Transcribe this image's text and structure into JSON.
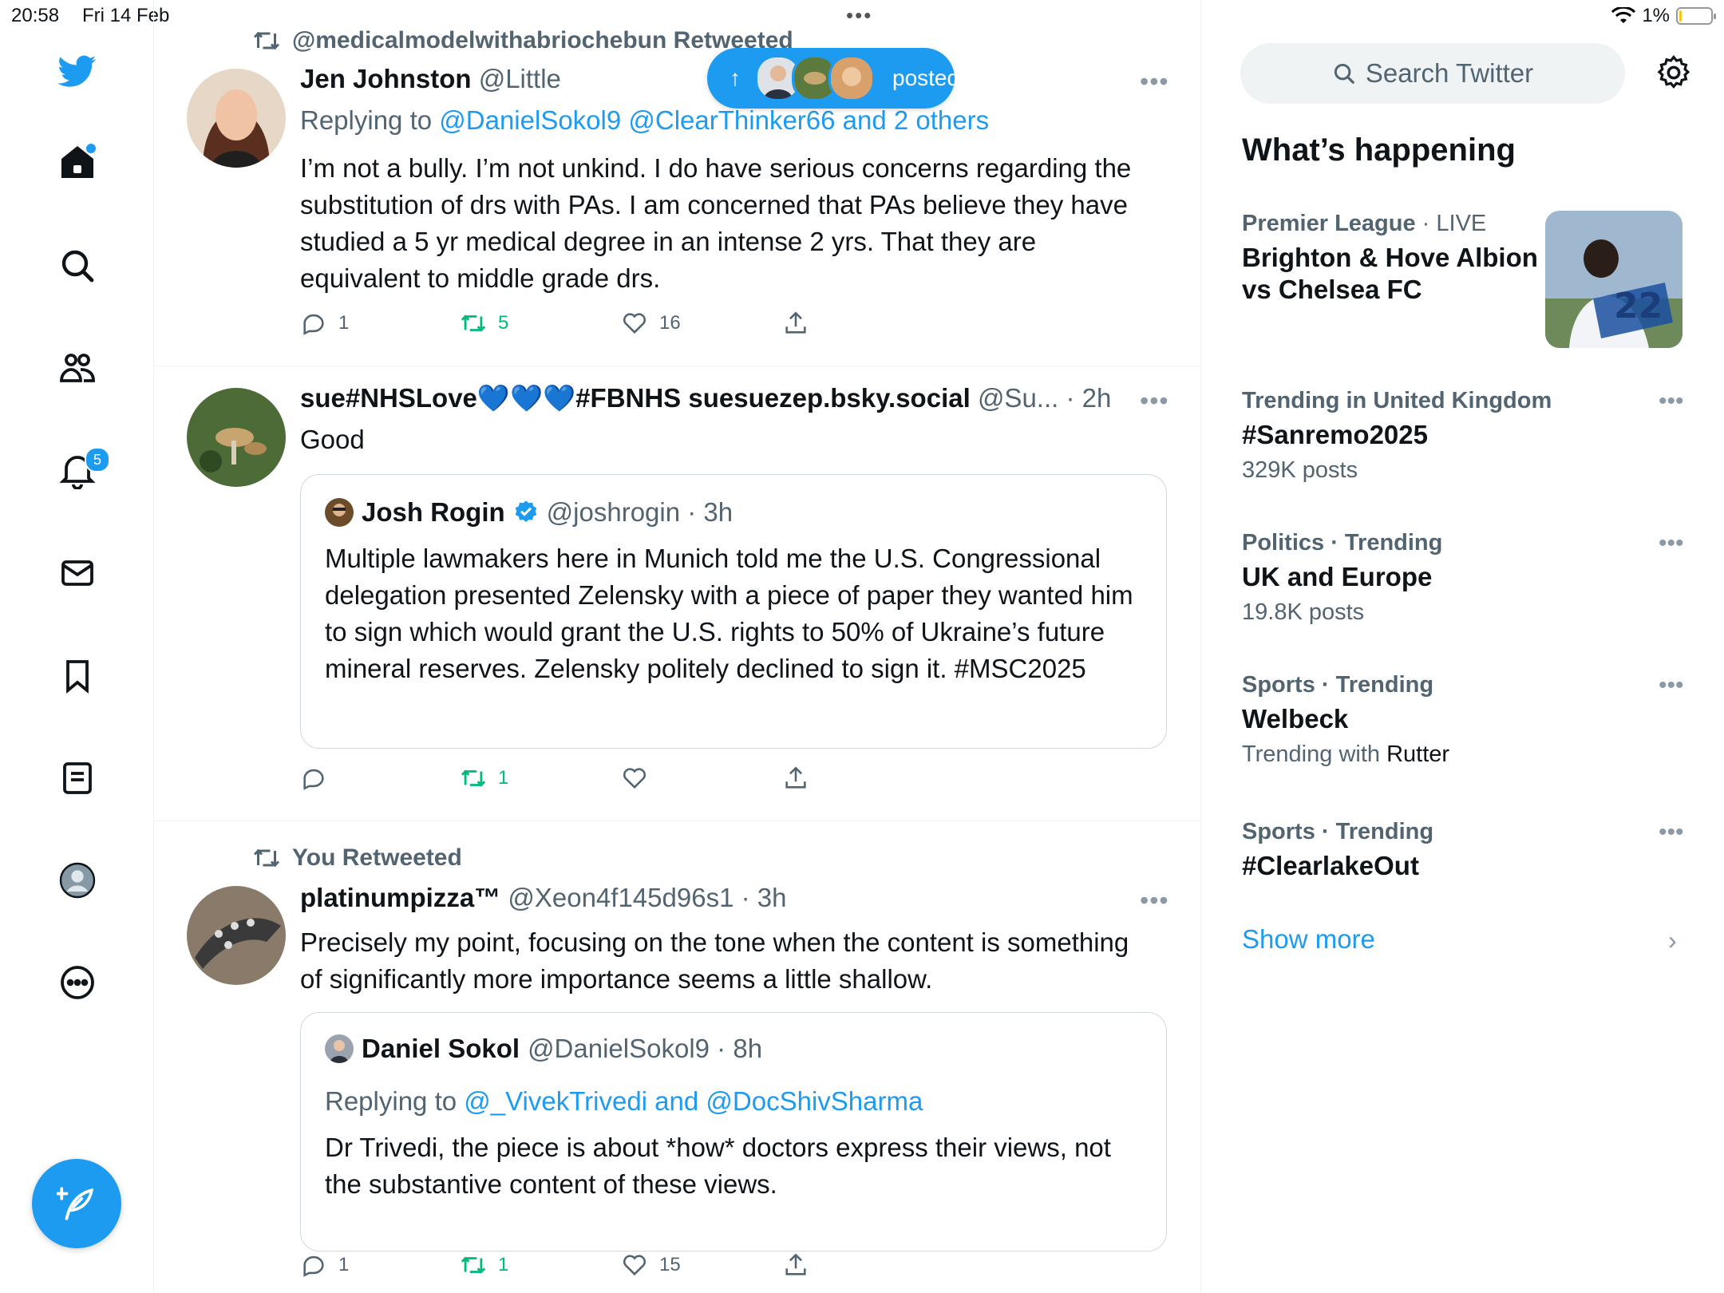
{
  "status": {
    "time": "20:58",
    "date": "Fri 14 Feb",
    "battery": "1%",
    "dots": "•••"
  },
  "nav": {
    "notifications_badge": "5"
  },
  "new_posts": {
    "label": "posted",
    "arrow": "↑"
  },
  "tweets": [
    {
      "context": "@medicalmodelwithabriochebun Retweeted",
      "name": "Jen Johnston",
      "handle": "@Little",
      "replying_prefix": "Replying to ",
      "replying_to": "@DanielSokol9 @ClearThinker66 and 2 others",
      "text": "I’m not a bully. I’m not unkind. I do have serious concerns regarding the substitution of drs with PAs. I am concerned that PAs believe they have studied a 5 yr medical degree in an intense 2 yrs. That they are equivalent to middle grade drs.",
      "replies": "1",
      "retweets": "5",
      "likes": "16"
    },
    {
      "name": "sue#NHSLove💙💙💙#FBNHS suesuezep.bsky.social",
      "handle": "@Su... · 2h",
      "text": "Good",
      "quote": {
        "name": "Josh Rogin",
        "handle": "@joshrogin · 3h",
        "text": "Multiple lawmakers here in Munich told me the U.S. Congressional delegation presented Zelensky with a piece of paper they wanted him to sign which would grant the U.S. rights to 50% of Ukraine’s future mineral reserves. Zelensky politely declined to sign it. #MSC2025"
      },
      "replies": "",
      "retweets": "1",
      "likes": ""
    },
    {
      "context": "You Retweeted",
      "name": "platinumpizza™",
      "handle": "@Xeon4f145d96s1 · 3h",
      "text": "Precisely my point, focusing on the tone when the content is something of significantly more importance seems a little shallow.",
      "quote": {
        "name": "Daniel Sokol",
        "handle": "@DanielSokol9 · 8h",
        "replying_prefix": "Replying to ",
        "replying_to": "@_VivekTrivedi and @DocShivSharma",
        "text": "Dr Trivedi, the piece is about *how* doctors express their views, not the substantive content of these views."
      },
      "replies": "1",
      "retweets": "1",
      "likes": "15"
    }
  ],
  "sidebar": {
    "search_placeholder": "Search Twitter",
    "heading": "What’s happening",
    "trends": [
      {
        "meta_bold": "Premier League",
        "meta_rest": " · LIVE",
        "title": "Brighton & Hove Albion vs Chelsea FC"
      },
      {
        "meta_bold": "Trending in United Kingdom",
        "meta_rest": "",
        "title": "#Sanremo2025",
        "sub": "329K posts"
      },
      {
        "meta_bold": "Politics · Trending",
        "meta_rest": "",
        "title": "UK and Europe",
        "sub": "19.8K posts"
      },
      {
        "meta_bold": "Sports · Trending",
        "meta_rest": "",
        "title": "Welbeck",
        "sub_prefix": "Trending with ",
        "sub_dark": "Rutter"
      },
      {
        "meta_bold": "Sports · Trending",
        "meta_rest": "",
        "title": "#ClearlakeOut"
      }
    ],
    "show_more": "Show more"
  },
  "colors": {
    "accent": "#1d9bf0",
    "retweet": "#00ba7c",
    "muted": "#536471"
  }
}
